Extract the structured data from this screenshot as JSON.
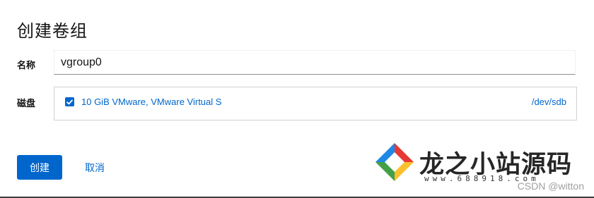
{
  "dialog": {
    "title": "创建卷组"
  },
  "form": {
    "name_label": "名称",
    "name_value": "vgroup0",
    "disks_label": "磁盘",
    "disks": [
      {
        "description": "10 GiB VMware, VMware Virtual S",
        "path": "/dev/sdb",
        "checked": true
      }
    ]
  },
  "actions": {
    "create_label": "创建",
    "cancel_label": "取消"
  },
  "watermark": {
    "site_name": "龙之小站源码",
    "site_url": "www.688918.com",
    "csdn": "CSDN @witton"
  },
  "colors": {
    "accent": "#0066cc",
    "text": "#151515",
    "border": "#d2d2d2"
  }
}
